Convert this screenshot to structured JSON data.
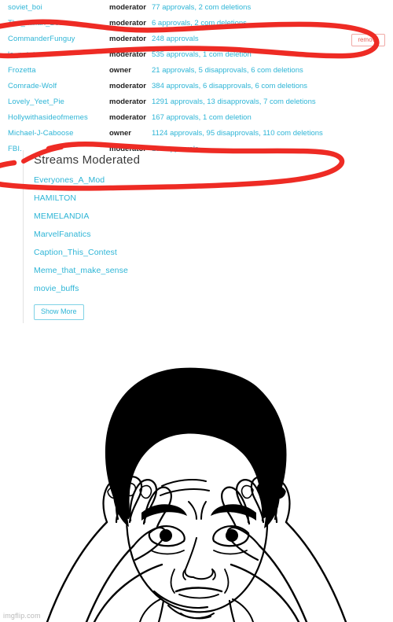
{
  "screenshot": {
    "moderator_table": {
      "rows": [
        {
          "name": "soviet_boi",
          "role": "moderator",
          "stats": "77 approvals, 2 com deletions",
          "remove_label": ""
        },
        {
          "name": "The_Italian_Bob",
          "role": "moderator",
          "stats": "6 approvals, 2 com deletions",
          "remove_label": ""
        },
        {
          "name": "CommanderFunguy",
          "role": "moderator",
          "stats": "248 approvals",
          "remove_label": "remove"
        },
        {
          "name": "le_potato",
          "role": "moderator",
          "stats": "535 approvals, 1 com deletion",
          "remove_label": ""
        },
        {
          "name": "Frozetta",
          "role": "owner",
          "stats": "21 approvals, 5 disapprovals, 6 com deletions",
          "remove_label": ""
        },
        {
          "name": "Comrade-Wolf",
          "role": "moderator",
          "stats": "384 approvals, 6 disapprovals, 6 com deletions",
          "remove_label": ""
        },
        {
          "name": "Lovely_Yeet_Pie",
          "role": "moderator",
          "stats": "1291 approvals, 13 disapprovals, 7 com deletions",
          "remove_label": ""
        },
        {
          "name": "Hollywithasideofmemes",
          "role": "moderator",
          "stats": "167 approvals, 1 com deletion",
          "remove_label": ""
        },
        {
          "name": "Michael-J-Caboose",
          "role": "owner",
          "stats": "1124 approvals, 95 disapprovals, 110 com deletions",
          "remove_label": ""
        },
        {
          "name": "FBI.",
          "role": "moderator",
          "stats": "199 approvals",
          "remove_label": ""
        }
      ]
    },
    "streams_moderated": {
      "heading": "Streams Moderated",
      "links": [
        "Everyones_A_Mod",
        "HAMILTON",
        "MEMELANDIA",
        "MarvelFanatics",
        "Caption_This_Contest",
        "Meme_that_make_sense",
        "movie_buffs"
      ],
      "show_more_label": "Show More"
    },
    "annotation": {
      "color": "#ee2b24",
      "description": "hand-drawn red circle around CommanderFunguy row and around Streams Moderated / Everyones_A_Mod"
    }
  },
  "meme": {
    "name": "jackie-chan-confused",
    "watermark": "imgflip.com",
    "top_text": "",
    "bottom_text": ""
  }
}
